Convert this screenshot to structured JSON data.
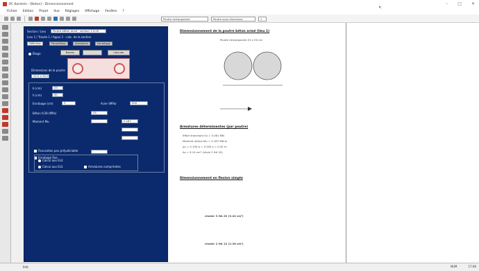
{
  "window": {
    "title": "RC Karstein - [Beton] - Dimensionnement",
    "controls": [
      "–",
      "□",
      "✕"
    ]
  },
  "menu": [
    "Fichier",
    "Edition",
    "Projet",
    "Vue",
    "Réglages",
    "Affichage",
    "Fenêtre",
    "?"
  ],
  "toolbar": {
    "combo1": "Poutre rectangulaire",
    "combo2": "Poutre sous dimension",
    "combo3": "1"
  },
  "panel": {
    "section_label": "Section / Lieu",
    "section_value": "Poutre béton armé - section 1.0.00",
    "section_sub": "Lieu 1 / Travée 1 / Appui 1 - calc. de la section",
    "tabs": [
      "Définition",
      "Paramètres",
      "Armatures",
      "Ferraillage"
    ],
    "mode_label": "Étage",
    "btn_pose": "Barres",
    "btn_calc": "Calculer",
    "dim_label": "Dimensions de la poutre",
    "dim_value": "25.0 x 50.0",
    "fields": [
      {
        "label": "b (cm)",
        "value": "25"
      },
      {
        "label": "h (cm)",
        "value": "50"
      },
      {
        "label": "Enrobage (cm)",
        "value": "3"
      },
      {
        "label": "Acier (MPa)",
        "value": "500"
      },
      {
        "label": "Béton fc28 (MPa)",
        "value": "25"
      },
      {
        "label": "Moment Mu",
        "value": "0.167"
      }
    ],
    "options": [
      "Fissuration peu préjudiciable",
      "Enrobage fixe"
    ],
    "radio_a": "Calcul aux ELU",
    "radio_b": "Calcul aux ELS",
    "check_c": "Armatures comprimées"
  },
  "doc": {
    "h1": "Dimensionnement de la poutre béton armé (lieu 1)",
    "t1": "Poutre rectangulaire 25 x 50 cm",
    "h2": "Armatures déterminantes (par poutre)",
    "h3": "Dimensionnement en flexion simple",
    "t_lines": [
      "Effort tranchant Vu = 0.061 MN",
      "Moment ultime Mu = 0.167 MN.m",
      "µu = 0.150  α = 0.204  z = 0.42 m",
      "As = 9.14 cm² (choix 3 HA 20)"
    ],
    "result1": "choisir 3 HA 20 (9.42 cm²)",
    "result2": "choisir 2 HA 12 (2.26 cm²)"
  },
  "status": {
    "left": "Prêt",
    "mid": "",
    "right1": "NUM",
    "right2": "17:06"
  }
}
